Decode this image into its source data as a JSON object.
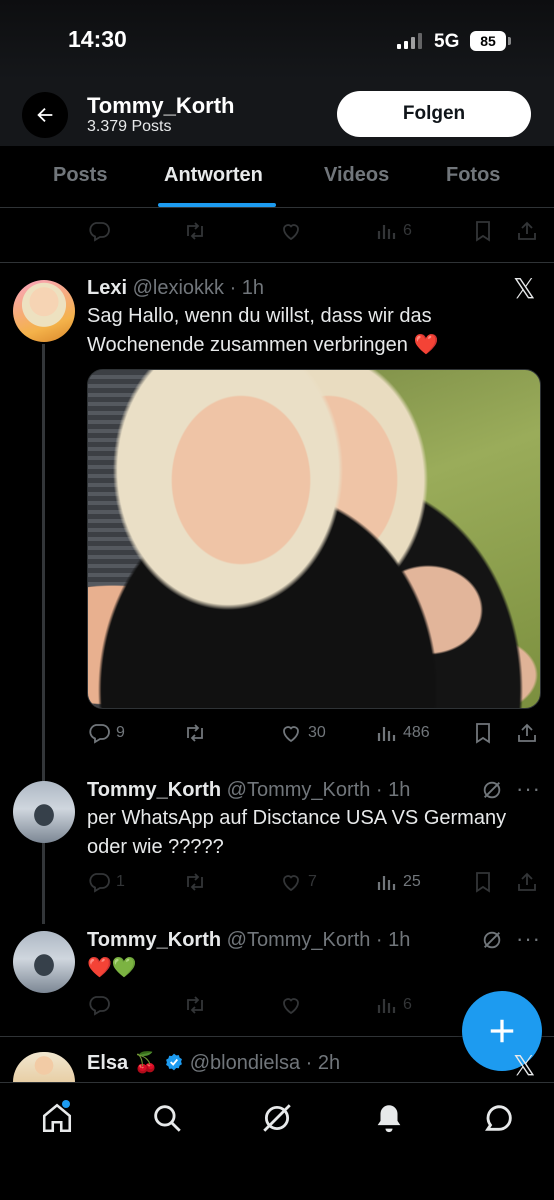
{
  "status_bar": {
    "time": "14:30",
    "network": "5G",
    "battery": "85"
  },
  "header": {
    "profile_name": "Tommy_Korth",
    "post_count": "3.379 Posts",
    "follow_label": "Folgen"
  },
  "tabs": [
    {
      "label": "Posts",
      "active": false
    },
    {
      "label": "Antworten",
      "active": true
    },
    {
      "label": "Videos",
      "active": false
    },
    {
      "label": "Fotos",
      "active": false
    }
  ],
  "top_partial_tweet": {
    "views": "6"
  },
  "tweets": [
    {
      "name": "Lexi",
      "handle_time": "@lexiokkk · 1h",
      "text": "Sag Hallo, wenn du willst, dass wir das Wochenende zusammen verbringen ❤️",
      "replies": "9",
      "likes": "30",
      "views": "486",
      "badge_icon": "x-logo-icon"
    },
    {
      "name": "Tommy_Korth",
      "handle_time": "@Tommy_Korth · 1h",
      "text": "per WhatsApp auf Disctance USA VS Germany oder wie ?????",
      "replies": "1",
      "likes": "7",
      "views": "25",
      "more": "···"
    },
    {
      "name": "Tommy_Korth",
      "handle_time": "@Tommy_Korth · 1h",
      "text": "❤️💚",
      "views": "6",
      "more": "···"
    },
    {
      "name": "Elsa 🍒",
      "handle_time": "@blondielsa · 2h",
      "verified": true
    }
  ],
  "colors": {
    "accent": "#1d9bf0",
    "muted": "#71767b",
    "text": "#e7e9ea",
    "border": "#2f3336"
  },
  "bottom_nav": [
    "home-icon",
    "search-icon",
    "grok-icon",
    "notifications-icon",
    "messages-icon"
  ]
}
